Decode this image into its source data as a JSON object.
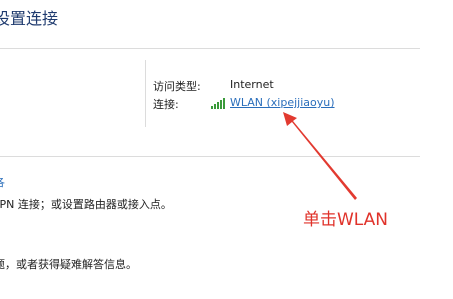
{
  "header": {
    "title": "设置连接"
  },
  "connection": {
    "access_type_label": "访问类型:",
    "access_type_value": "Internet",
    "connections_label": "连接:",
    "wlan_link": "WLAN (xipejjiaoyu)"
  },
  "settings": {
    "section_link": "各",
    "line1": "VPN 连接；或设置路由器或接入点。",
    "line2": "题，或者获得疑难解答信息。"
  },
  "annotation": {
    "text": "单击WLAN",
    "color": "#e0322a"
  },
  "colors": {
    "link": "#2a6ebb",
    "title": "#1e3a6e",
    "wifi_bars": "#3a9a3a"
  }
}
